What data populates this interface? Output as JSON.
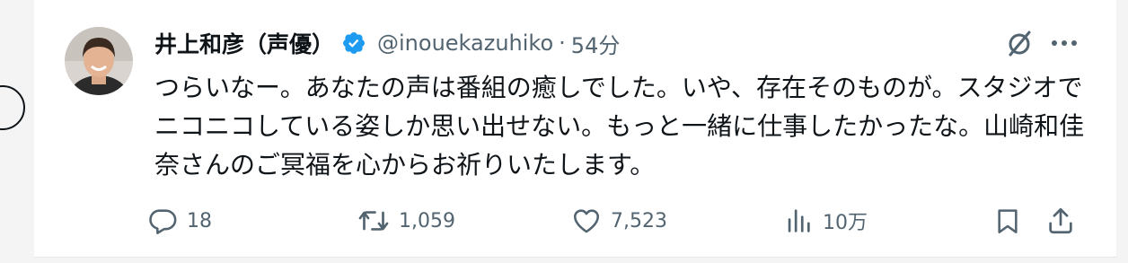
{
  "tweet": {
    "display_name": "井上和彦（声優）",
    "handle": "@inouekazuhiko",
    "separator": "·",
    "time": "54分",
    "text": "つらいなー。あなたの声は番組の癒しでした。いや、存在そのものが。スタジオでニコニコしている姿しか思い出せない。もっと一緒に仕事したかったな。山崎和佳奈さんのご冥福を心からお祈りいたします。"
  },
  "actions": {
    "replies": "18",
    "reposts": "1,059",
    "likes": "7,523",
    "views": "10万"
  },
  "icons": {
    "verified": "verified-badge-icon",
    "grok": "grok-icon",
    "more": "more-icon",
    "reply": "reply-icon",
    "repost": "repost-icon",
    "like": "heart-icon",
    "views": "analytics-icon",
    "bookmark": "bookmark-icon",
    "share": "share-icon"
  },
  "colors": {
    "verified_blue": "#1d9bf0",
    "text_primary": "#0f1419",
    "text_secondary": "#536471"
  }
}
